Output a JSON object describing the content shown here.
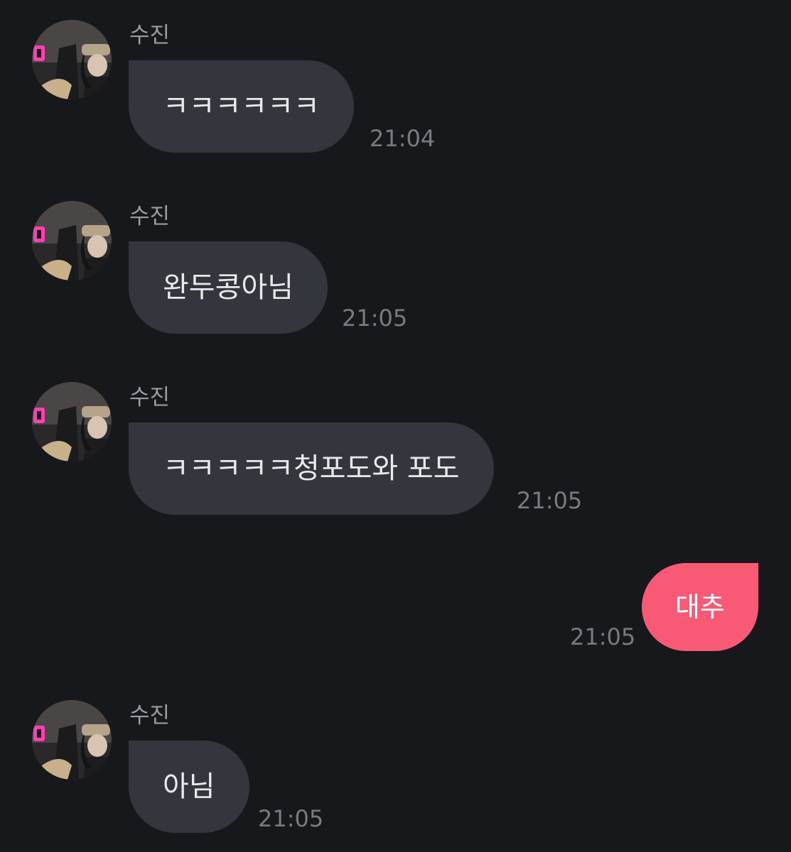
{
  "messages": [
    {
      "sender": "수진",
      "text": "ㅋㅋㅋㅋㅋㅋ",
      "time": "21:04"
    },
    {
      "sender": "수진",
      "text": "완두콩아님",
      "time": "21:05"
    },
    {
      "sender": "수진",
      "text": "ㅋㅋㅋㅋㅋ청포도와 포도",
      "time": "21:05"
    },
    {
      "sender": "me",
      "text": "대추",
      "time": "21:05"
    },
    {
      "sender": "수진",
      "text": "아님",
      "time": "21:05"
    }
  ],
  "colors": {
    "background": "#17181c",
    "incoming_bubble": "#34363d",
    "outgoing_bubble": "#f85a75",
    "sender_text": "#9b9ca1",
    "time_text": "#7a7b80"
  },
  "icons": {
    "avatar": "profile-photo"
  }
}
